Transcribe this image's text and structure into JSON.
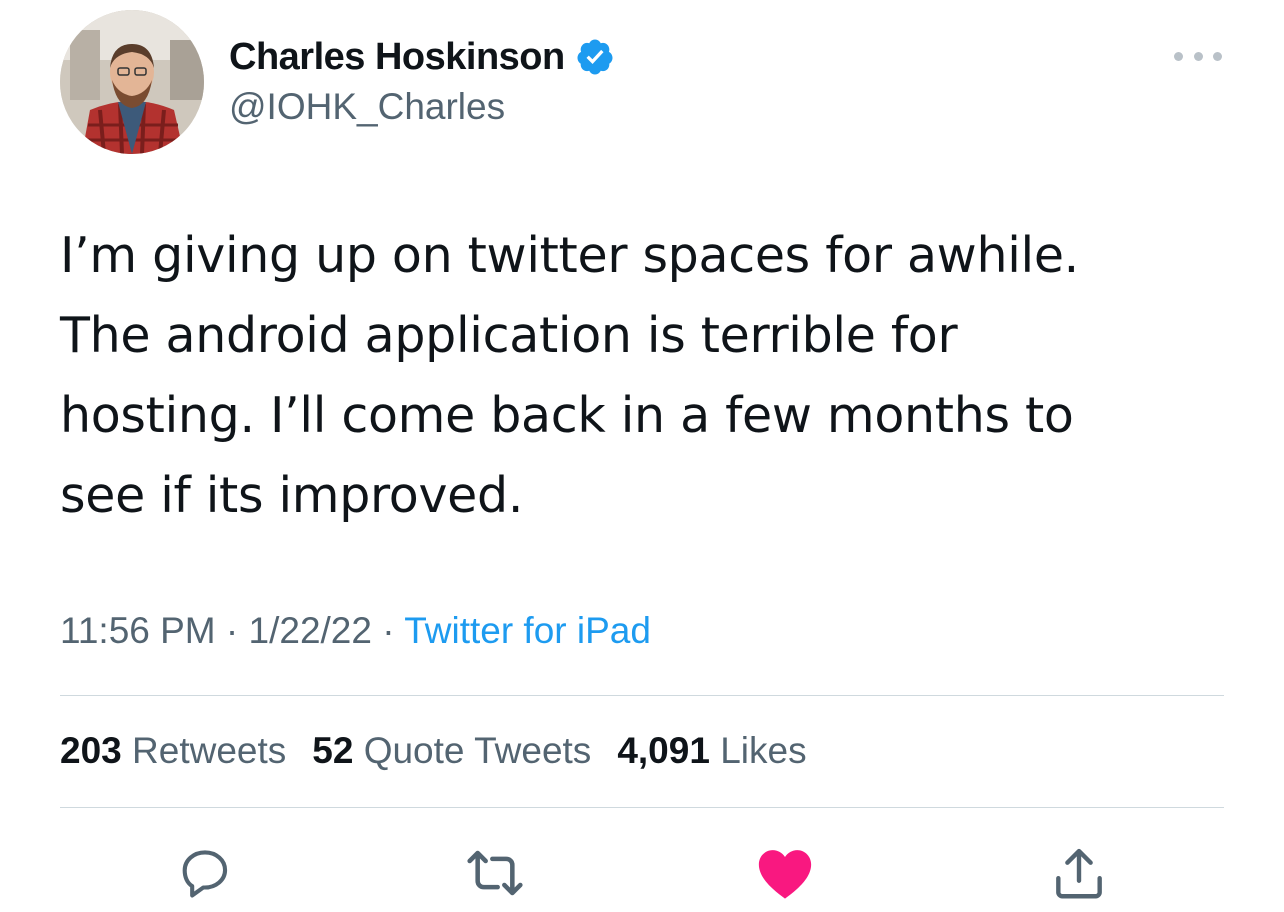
{
  "author": {
    "display_name": "Charles Hoskinson",
    "handle": "@IOHK_Charles",
    "verified_icon": "verified-badge-icon",
    "verified_color": "#1d9bf0"
  },
  "tweet": {
    "text_lines": [
      "I’m giving up on twitter spaces for awhile.",
      "The android application is terrible for",
      "hosting. I’ll come back in a few months to",
      "see if its improved."
    ],
    "time": "11:56 PM",
    "separator": "·",
    "date": "1/22/22",
    "source": "Twitter for iPad"
  },
  "stats": {
    "retweets_count": "203",
    "retweets_label": "Retweets",
    "quotes_count": "52",
    "quotes_label": "Quote Tweets",
    "likes_count": "4,091",
    "likes_label": "Likes"
  },
  "actions": [
    {
      "icon": "reply-icon"
    },
    {
      "icon": "retweet-icon"
    },
    {
      "icon": "heart-icon-liked",
      "color": "#f91880"
    },
    {
      "icon": "share-icon"
    }
  ],
  "colors": {
    "text_primary": "#0f1419",
    "text_secondary": "#536471",
    "link": "#1d9bf0",
    "divider": "#cfd9de"
  }
}
